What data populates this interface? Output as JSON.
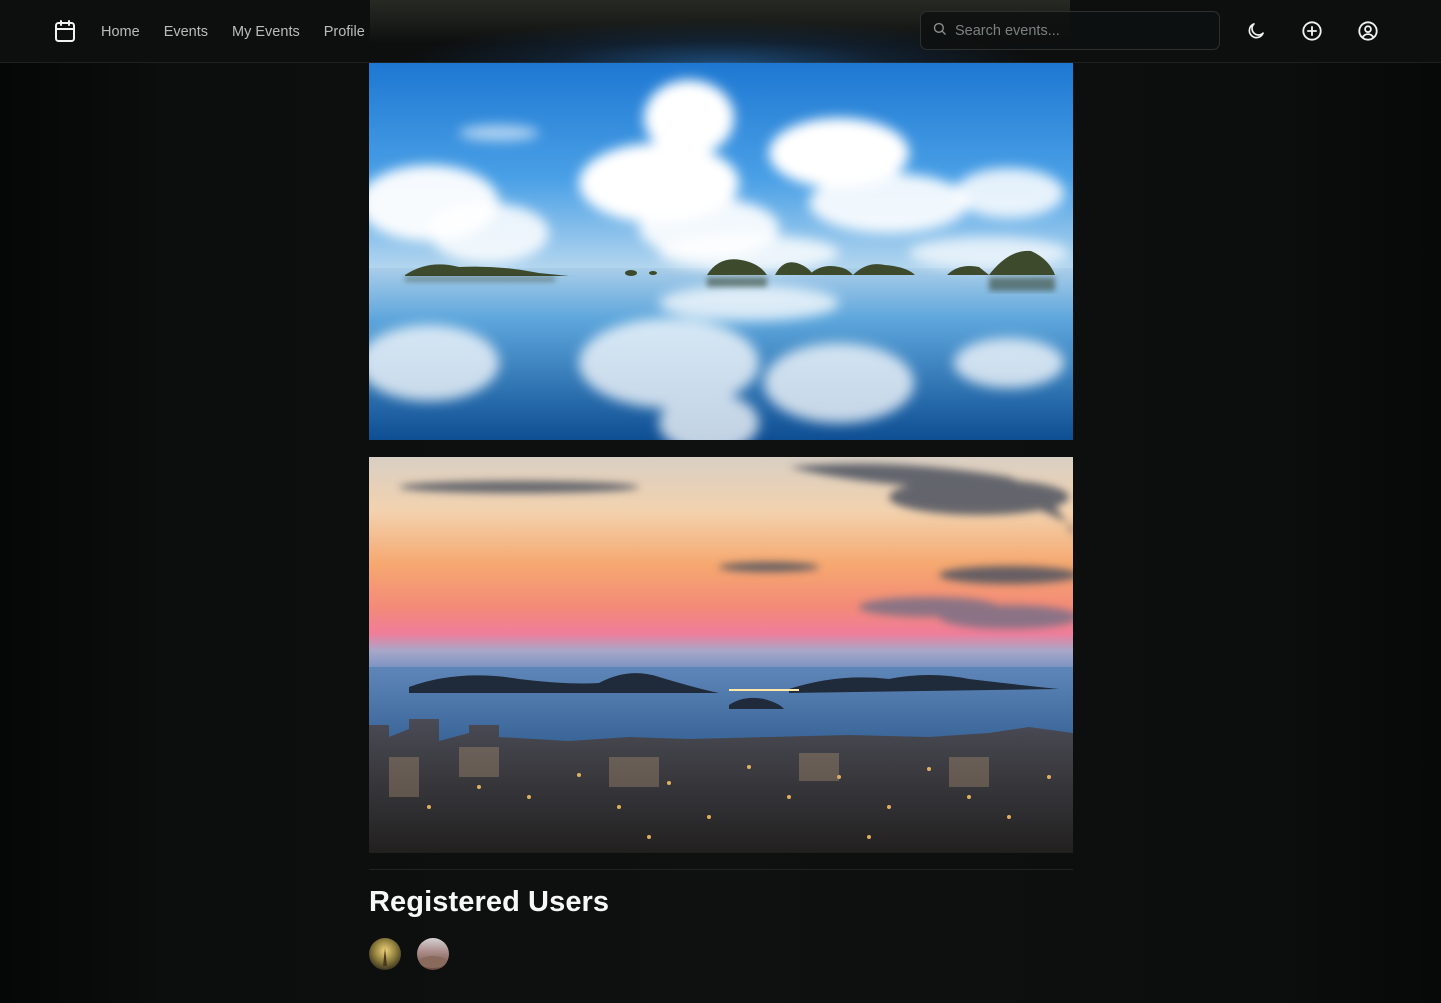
{
  "header": {
    "logo_icon": "calendar-icon",
    "nav": [
      {
        "label": "Home"
      },
      {
        "label": "Events"
      },
      {
        "label": "My Events"
      },
      {
        "label": "Profile"
      }
    ],
    "search": {
      "placeholder": "Search events...",
      "value": "",
      "icon": "search-icon"
    },
    "actions": [
      {
        "icon": "moon-icon"
      },
      {
        "icon": "plus-circle-icon"
      },
      {
        "icon": "user-circle-icon"
      }
    ]
  },
  "gallery": [
    {
      "subject": "sea-islands-clouds-reflection"
    },
    {
      "subject": "coastal-city-sunset-islands"
    }
  ],
  "registered_users": {
    "title": "Registered Users",
    "avatars": [
      {
        "tone": "#8a7a3a"
      },
      {
        "tone": "#8b6a5e"
      }
    ]
  },
  "colors": {
    "background": "#0f1111",
    "text": "#f5f5f5",
    "nav_text": "#b9bcbc",
    "border": "#2c3030"
  }
}
